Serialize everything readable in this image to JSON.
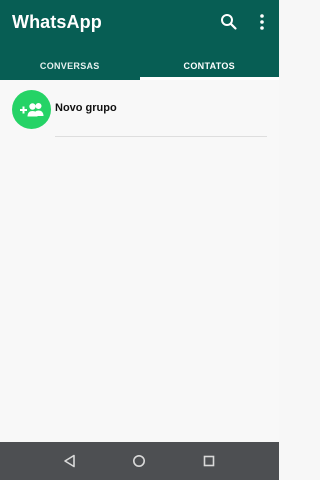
{
  "app": {
    "title": "WhatsApp",
    "colors": {
      "header": "#075e54",
      "accent_green": "#25d366",
      "nav_bar": "#4d4f52"
    }
  },
  "toolbar": {
    "search_icon": "search-icon",
    "menu_icon": "more-vert-icon"
  },
  "tabs": [
    {
      "label": "CONVERSAS",
      "selected": false
    },
    {
      "label": "CONTATOS",
      "selected": true
    }
  ],
  "contacts": {
    "items": [
      {
        "label": "Novo grupo",
        "icon": "add-group-icon"
      }
    ]
  },
  "system_nav": {
    "back_icon": "back-triangle-icon",
    "home_icon": "home-circle-icon",
    "recents_icon": "recents-square-icon"
  }
}
